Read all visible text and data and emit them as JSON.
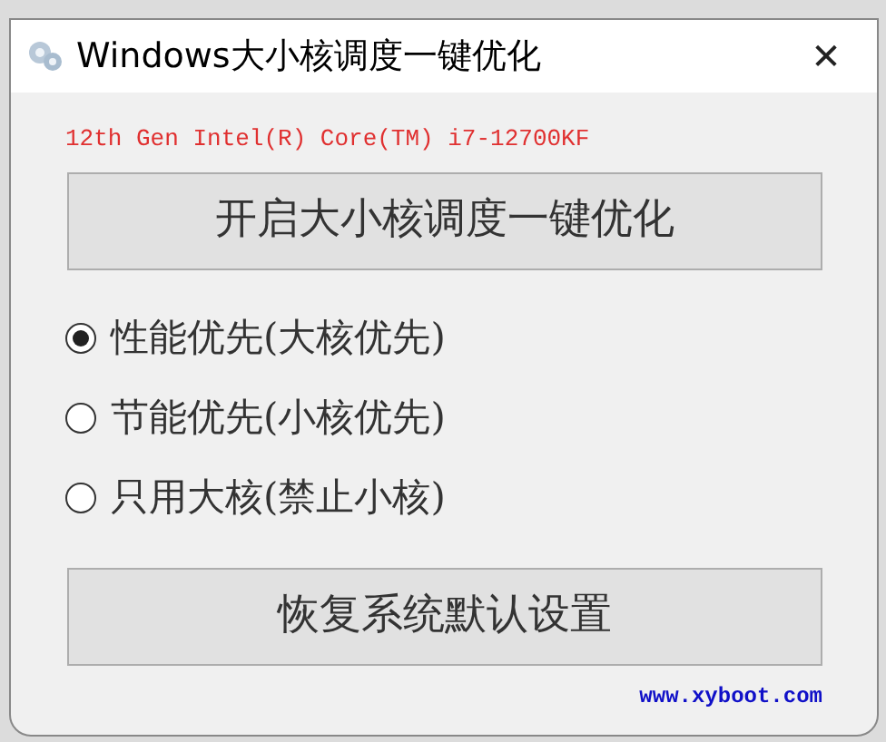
{
  "window": {
    "title": "Windows大小核调度一键优化",
    "close": "✕"
  },
  "cpu": "12th Gen Intel(R) Core(TM) i7-12700KF",
  "optimize_button": "开启大小核调度一键优化",
  "modes": [
    {
      "label": "性能优先(大核优先)",
      "selected": true
    },
    {
      "label": "节能优先(小核优先)",
      "selected": false
    },
    {
      "label": "只用大核(禁止小核)",
      "selected": false
    }
  ],
  "restore_button": "恢复系统默认设置",
  "link": "www.xyboot.com"
}
